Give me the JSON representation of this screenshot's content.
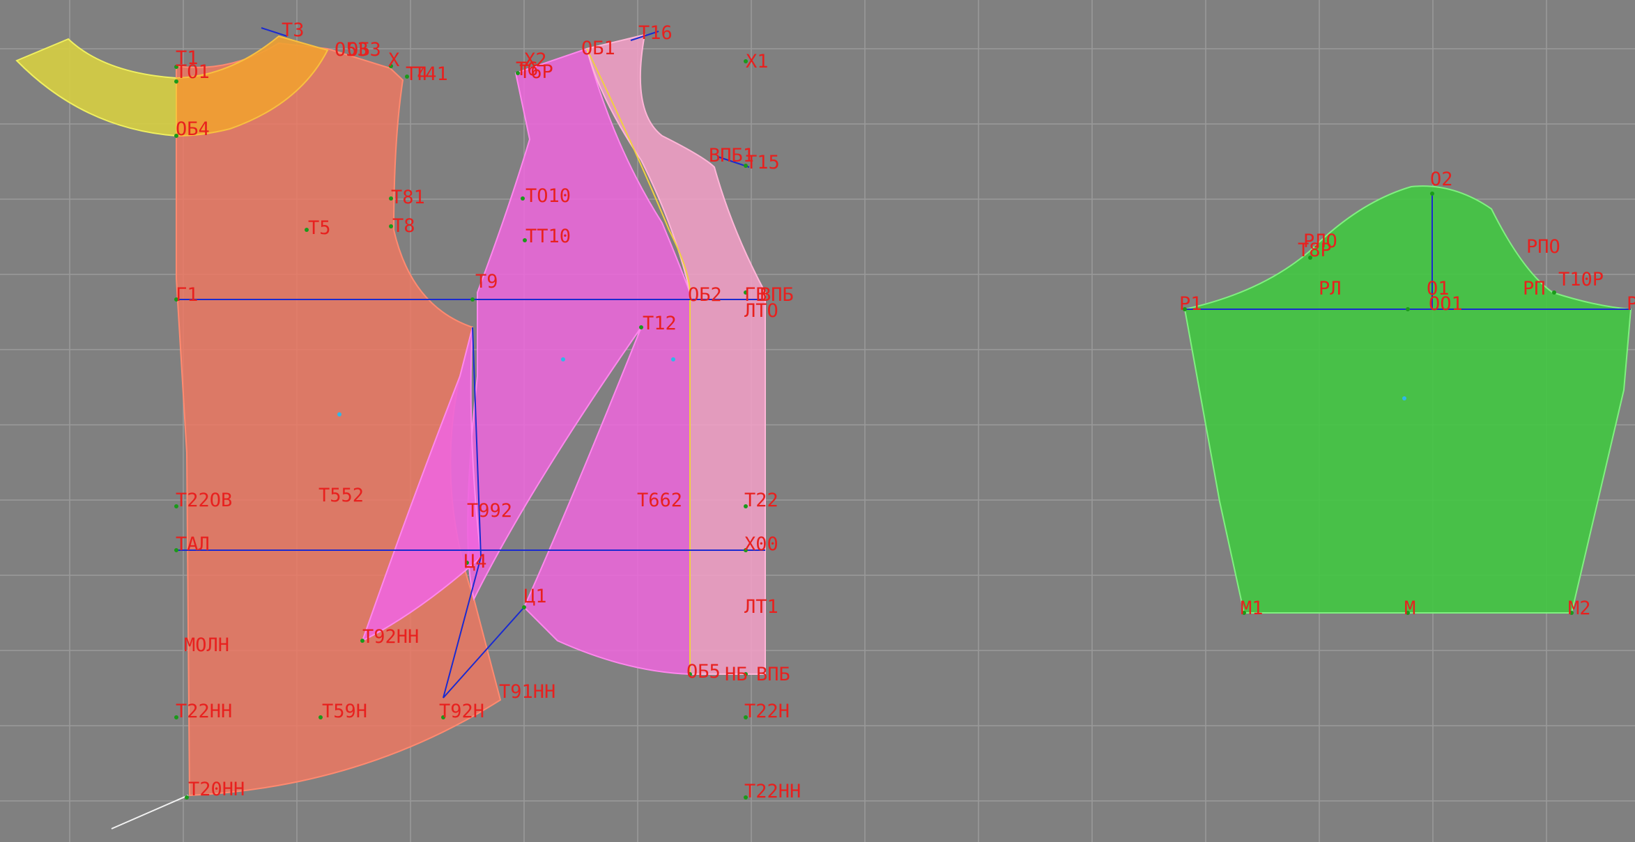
{
  "colors": {
    "background": "#808080",
    "grid": "#9a9a9a",
    "label": "#e8201e",
    "front_piece": "#f07860",
    "side_piece": "#ee6ee0",
    "facing_piece": "#f4a0c8",
    "collar_piece": "#d8d040",
    "yoke_piece": "#f0a030",
    "sleeve_piece": "#40c840",
    "construction_line": "#1a2ad0"
  },
  "labels": {
    "T1": "T1",
    "TO1": "TO1",
    "T3": "T3",
    "O53": "O53",
    "OB3": "OБ3",
    "X": "X",
    "T4": "T4",
    "T41": "T41",
    "X2": "X2",
    "T6": "T6",
    "T6P": "T6P",
    "OB1": "OБ1",
    "T16": "T16",
    "X1": "X1",
    "OB4": "OБ4",
    "VPB1": "BПБ1",
    "T15": "T15",
    "T81": "T81",
    "T010": "TO10",
    "T5": "T5",
    "T8": "T8",
    "TT10": "TT10",
    "G1": "Г1",
    "T9": "T9",
    "OB2": "OБ2",
    "GB": "ГB",
    "VPB": "BПБ",
    "LT0": "ЛТО",
    "T12": "T12",
    "T22OB": "T22OB",
    "T552": "T552",
    "T992": "T992",
    "T662": "T662",
    "T22": "T22",
    "TAL": "TAЛ",
    "X00": "X00",
    "C4": "Ц4",
    "C1": "Ц1",
    "LT1": "ЛT1",
    "MOLN": "MOЛH",
    "T92NN": "T92HH",
    "OB5": "OБ5",
    "NB": "HБ",
    "VPB_low": "BПБ",
    "T91NN": "T91HH",
    "T22NH": "T22HH",
    "T59N": "T59H",
    "T92N": "T92H",
    "T22N": "T22H",
    "T20NN": "T20HH",
    "T22NN": "T22HH",
    "O2": "O2",
    "RLO": "PЛO",
    "T8P": "T8P",
    "RPO": "PПO",
    "RL": "PЛ",
    "O1": "O1",
    "RP": "PП",
    "T10P": "T10P",
    "R1": "P1",
    "O01": "OO1",
    "P_right": "P",
    "M1": "M1",
    "M": "M",
    "M2": "M2"
  }
}
